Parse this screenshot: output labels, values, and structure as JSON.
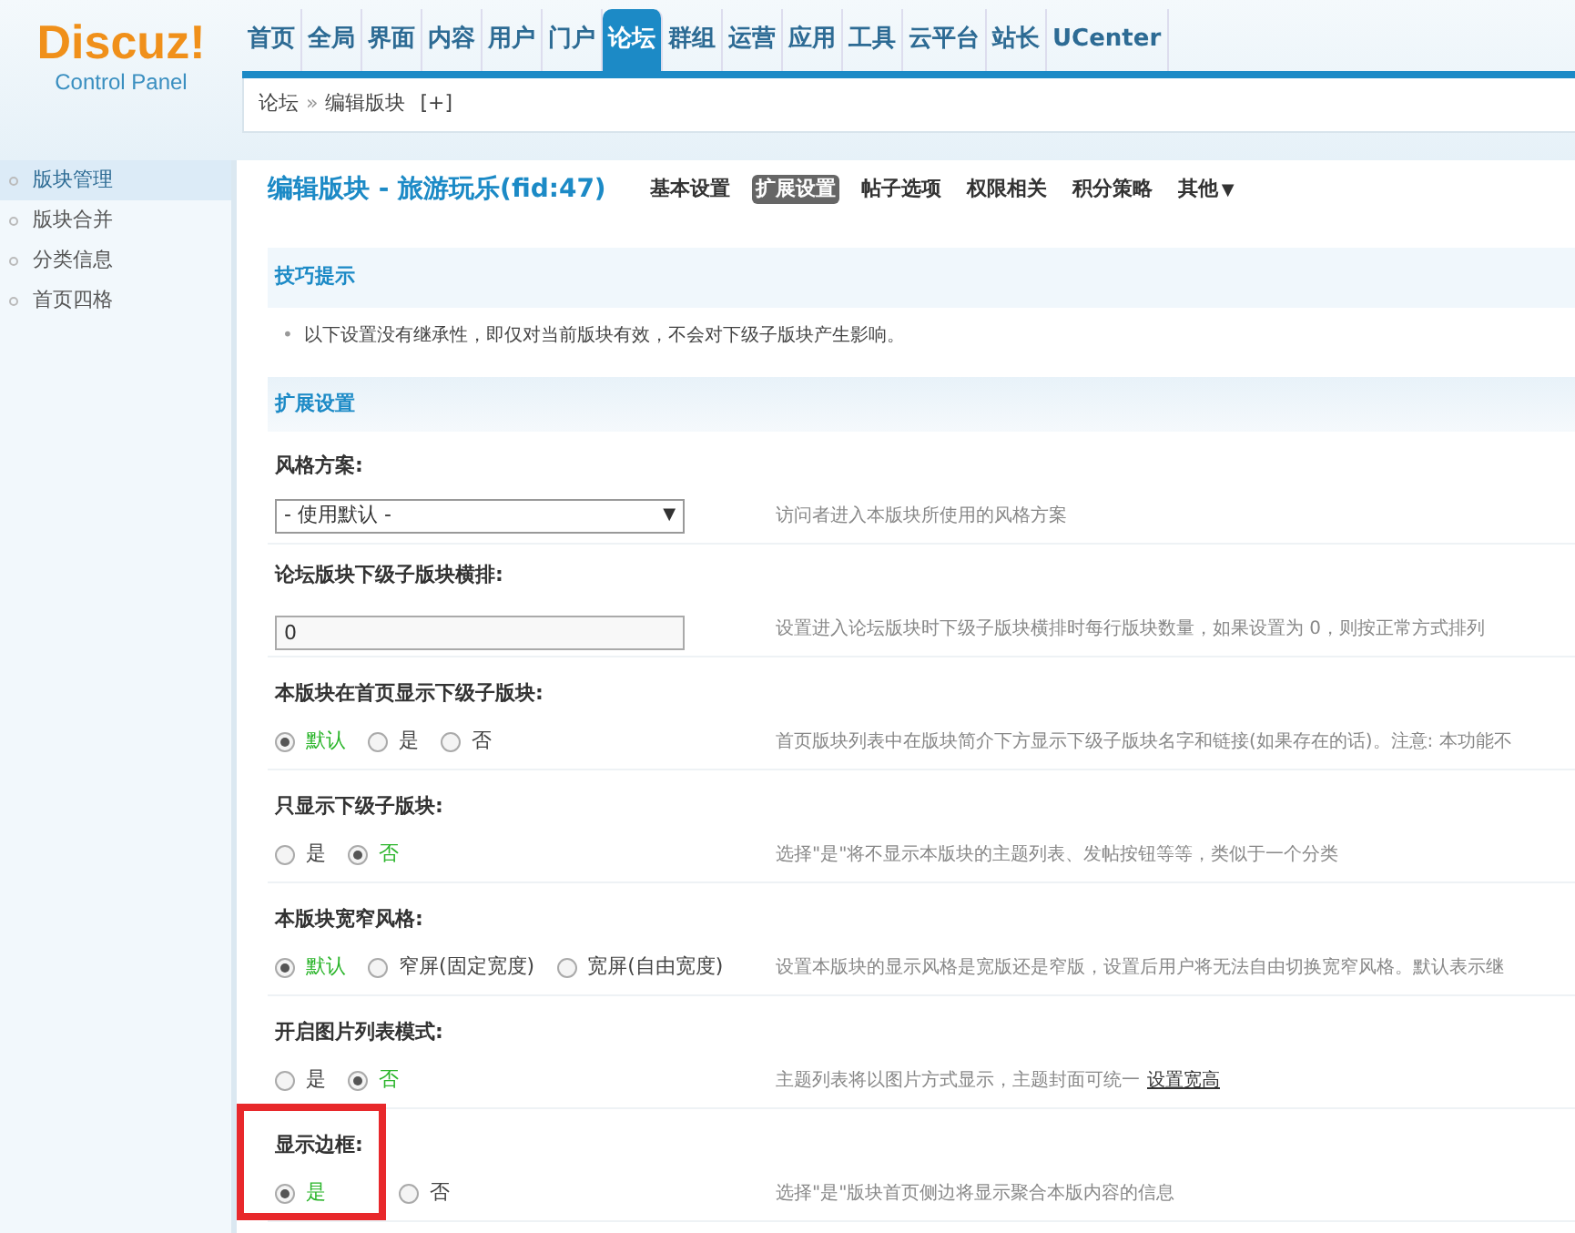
{
  "logo": {
    "title": "Discuz!",
    "subtitle": "Control Panel"
  },
  "nav": [
    {
      "label": "首页",
      "selected": false
    },
    {
      "label": "全局",
      "selected": false
    },
    {
      "label": "界面",
      "selected": false
    },
    {
      "label": "内容",
      "selected": false
    },
    {
      "label": "用户",
      "selected": false
    },
    {
      "label": "门户",
      "selected": false
    },
    {
      "label": "论坛",
      "selected": true
    },
    {
      "label": "群组",
      "selected": false
    },
    {
      "label": "运营",
      "selected": false
    },
    {
      "label": "应用",
      "selected": false
    },
    {
      "label": "工具",
      "selected": false
    },
    {
      "label": "云平台",
      "selected": false
    },
    {
      "label": "站长",
      "selected": false
    },
    {
      "label": "UCenter",
      "selected": false
    }
  ],
  "breadcrumb": {
    "items": [
      "论坛",
      "编辑版块"
    ],
    "separator": "»",
    "add": "[+]"
  },
  "sidebar": {
    "items": [
      {
        "label": "版块管理",
        "selected": true
      },
      {
        "label": "版块合并",
        "selected": false
      },
      {
        "label": "分类信息",
        "selected": false
      },
      {
        "label": "首页四格",
        "selected": false
      }
    ]
  },
  "page_title": "编辑版块 - 旅游玩乐(fid:47)",
  "tabs": [
    {
      "label": "基本设置",
      "selected": false
    },
    {
      "label": "扩展设置",
      "selected": true
    },
    {
      "label": "帖子选项",
      "selected": false
    },
    {
      "label": "权限相关",
      "selected": false
    },
    {
      "label": "积分策略",
      "selected": false
    },
    {
      "label": "其他",
      "selected": false,
      "dropdown": "▼"
    }
  ],
  "tips": {
    "title": "技巧提示",
    "bullet": "•",
    "items": [
      "以下设置没有继承性，即仅对当前版块有效，不会对下级子版块产生影响。"
    ]
  },
  "section_title": "扩展设置",
  "settings": [
    {
      "kind": "select",
      "label": "风格方案:",
      "value": "- 使用默认 -",
      "arrow": "▼",
      "description": "访问者进入本版块所使用的风格方案"
    },
    {
      "kind": "input",
      "label": "论坛版块下级子版块横排:",
      "value": "0",
      "description": "设置进入论坛版块时下级子版块横排时每行版块数量，如果设置为 0，则按正常方式排列"
    },
    {
      "kind": "radio",
      "label": "本版块在首页显示下级子版块:",
      "options": [
        {
          "label": "默认",
          "selected": true
        },
        {
          "label": "是",
          "selected": false
        },
        {
          "label": "否",
          "selected": false
        }
      ],
      "description": "首页版块列表中在版块简介下方显示下级子版块名字和链接(如果存在的话)。注意: 本功能不"
    },
    {
      "kind": "radio",
      "label": "只显示下级子版块:",
      "options": [
        {
          "label": "是",
          "selected": false
        },
        {
          "label": "否",
          "selected": true
        }
      ],
      "description": "选择\"是\"将不显示本版块的主题列表、发帖按钮等等，类似于一个分类"
    },
    {
      "kind": "radio",
      "label": "本版块宽窄风格:",
      "options": [
        {
          "label": "默认",
          "selected": true
        },
        {
          "label": "窄屏(固定宽度)",
          "selected": false
        },
        {
          "label": "宽屏(自由宽度)",
          "selected": false
        }
      ],
      "description": "设置本版块的显示风格是宽版还是窄版，设置后用户将无法自由切换宽窄风格。默认表示继"
    },
    {
      "kind": "radio",
      "label": "开启图片列表模式:",
      "options": [
        {
          "label": "是",
          "selected": false
        },
        {
          "label": "否",
          "selected": true
        }
      ],
      "description": "主题列表将以图片方式显示，主题封面可统一",
      "link": "设置宽高"
    },
    {
      "kind": "radio",
      "label": "显示边框:",
      "highlighted": true,
      "options": [
        {
          "label": "是",
          "selected": true
        },
        {
          "label": "否",
          "selected": false
        }
      ],
      "description": "选择\"是\"版块首页侧边将显示聚合本版内容的信息"
    }
  ]
}
